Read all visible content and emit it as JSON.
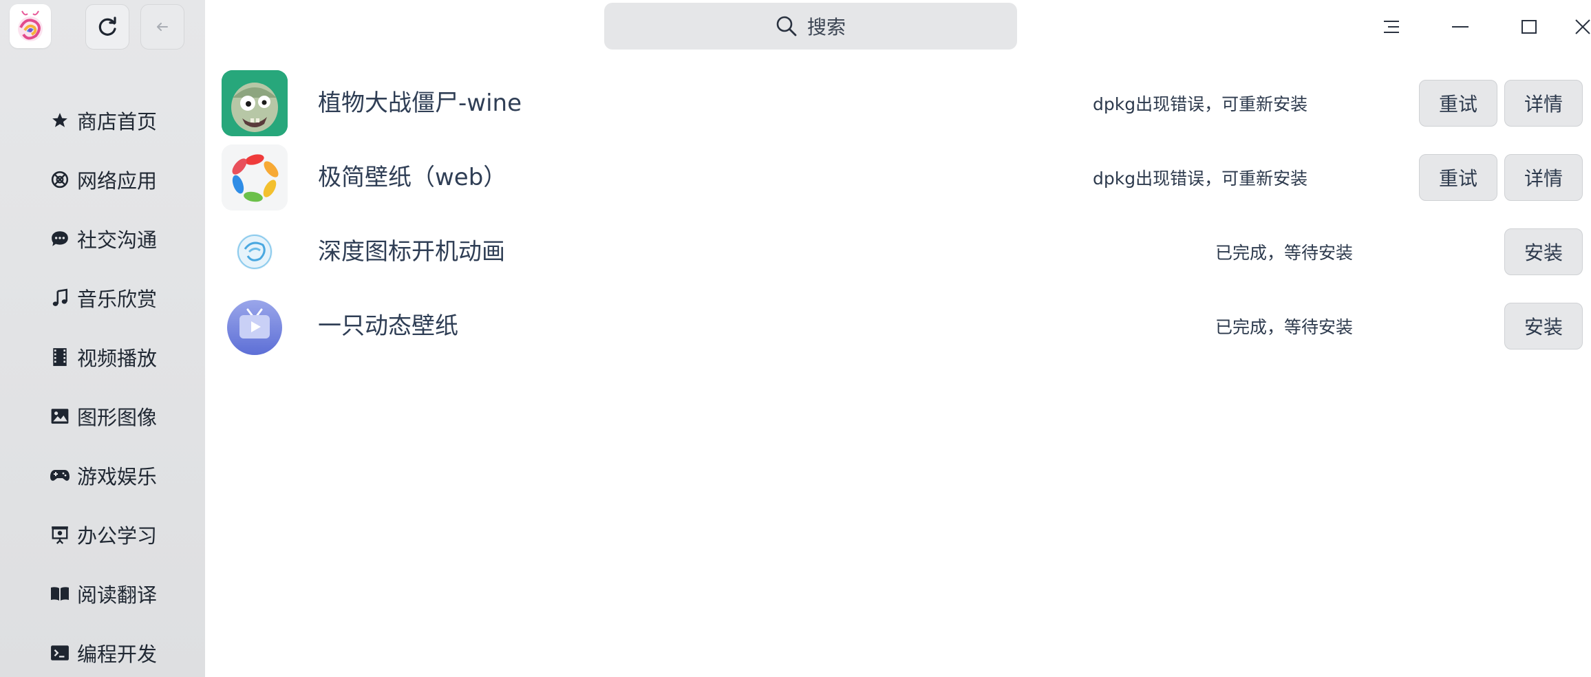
{
  "toolbar": {
    "refresh_icon": "refresh-icon",
    "back_icon": "arrow-left-icon"
  },
  "search": {
    "placeholder": "搜索"
  },
  "sidebar": {
    "items": [
      {
        "label": "商店首页",
        "icon": "star-icon"
      },
      {
        "label": "网络应用",
        "icon": "globe-icon"
      },
      {
        "label": "社交沟通",
        "icon": "chat-bubble-icon"
      },
      {
        "label": "音乐欣赏",
        "icon": "music-note-icon"
      },
      {
        "label": "视频播放",
        "icon": "film-icon"
      },
      {
        "label": "图形图像",
        "icon": "image-icon"
      },
      {
        "label": "游戏娱乐",
        "icon": "gamepad-icon"
      },
      {
        "label": "办公学习",
        "icon": "presentation-icon"
      },
      {
        "label": "阅读翻译",
        "icon": "book-icon"
      },
      {
        "label": "编程开发",
        "icon": "terminal-icon"
      }
    ]
  },
  "downloads": [
    {
      "name": "植物大战僵尸-wine",
      "status": "dpkg出现错误，可重新安装",
      "buttons": [
        "重试",
        "详情"
      ]
    },
    {
      "name": "极简壁纸（web）",
      "status": "dpkg出现错误，可重新安装",
      "buttons": [
        "重试",
        "详情"
      ]
    },
    {
      "name": "深度图标开机动画",
      "status": "已完成，等待安装",
      "buttons": [
        "安装"
      ]
    },
    {
      "name": "一只动态壁纸",
      "status": "已完成，等待安装",
      "buttons": [
        "安装"
      ]
    }
  ],
  "colors": {
    "sidebar_bg": "#e2e3e5",
    "button_bg": "#e6e7e9",
    "text_primary": "#2f3e55"
  }
}
